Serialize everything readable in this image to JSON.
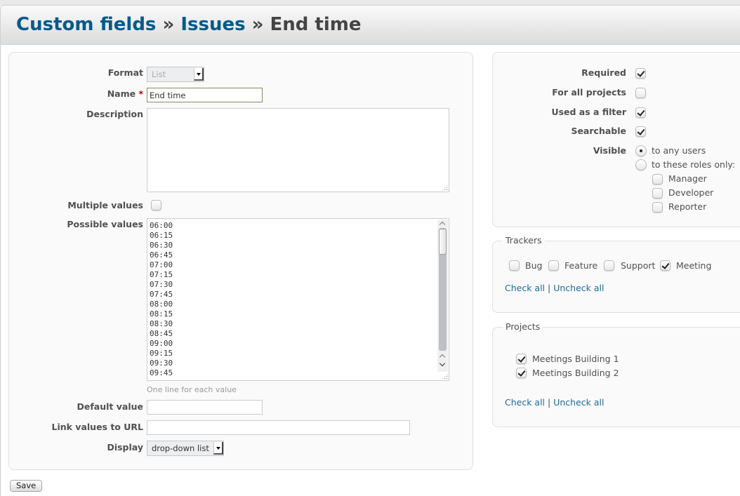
{
  "breadcrumb": {
    "items": [
      "Custom fields",
      "Issues"
    ],
    "separator": "»",
    "current": "End time"
  },
  "form": {
    "format": {
      "label": "Format",
      "value": "List"
    },
    "name": {
      "label": "Name",
      "required_mark": "*",
      "value": "End time"
    },
    "description": {
      "label": "Description",
      "value": ""
    },
    "multiple_values": {
      "label": "Multiple values",
      "checked": false
    },
    "possible_values": {
      "label": "Possible values",
      "values": [
        "06:00",
        "06:15",
        "06:30",
        "06:45",
        "07:00",
        "07:15",
        "07:30",
        "07:45",
        "08:00",
        "08:15",
        "08:30",
        "08:45",
        "09:00",
        "09:15",
        "09:30",
        "09:45"
      ],
      "hint": "One line for each value"
    },
    "default_value": {
      "label": "Default value",
      "value": ""
    },
    "link_values_to_url": {
      "label": "Link values to URL",
      "value": ""
    },
    "display": {
      "label": "Display",
      "value": "drop-down list"
    }
  },
  "options": {
    "required": {
      "label": "Required",
      "checked": true
    },
    "for_all_projects": {
      "label": "For all projects",
      "checked": false
    },
    "used_as_filter": {
      "label": "Used as a filter",
      "checked": true
    },
    "searchable": {
      "label": "Searchable",
      "checked": true
    },
    "visible": {
      "label": "Visible",
      "options": [
        {
          "label": "to any users",
          "selected": true
        },
        {
          "label": "to these roles only:",
          "selected": false
        }
      ],
      "roles": [
        {
          "label": "Manager",
          "checked": false
        },
        {
          "label": "Developer",
          "checked": false
        },
        {
          "label": "Reporter",
          "checked": false
        }
      ]
    }
  },
  "trackers": {
    "legend": "Trackers",
    "items": [
      {
        "label": "Bug",
        "checked": false
      },
      {
        "label": "Feature",
        "checked": false
      },
      {
        "label": "Support",
        "checked": false
      },
      {
        "label": "Meeting",
        "checked": true
      }
    ],
    "check_all": "Check all",
    "uncheck_all": "Uncheck all",
    "pipe": "|"
  },
  "projects": {
    "legend": "Projects",
    "items": [
      {
        "label": "Meetings Building 1",
        "checked": true
      },
      {
        "label": "Meetings Building 2",
        "checked": true
      }
    ],
    "check_all": "Check all",
    "uncheck_all": "Uncheck all",
    "pipe": "|"
  },
  "actions": {
    "save": "Save"
  }
}
